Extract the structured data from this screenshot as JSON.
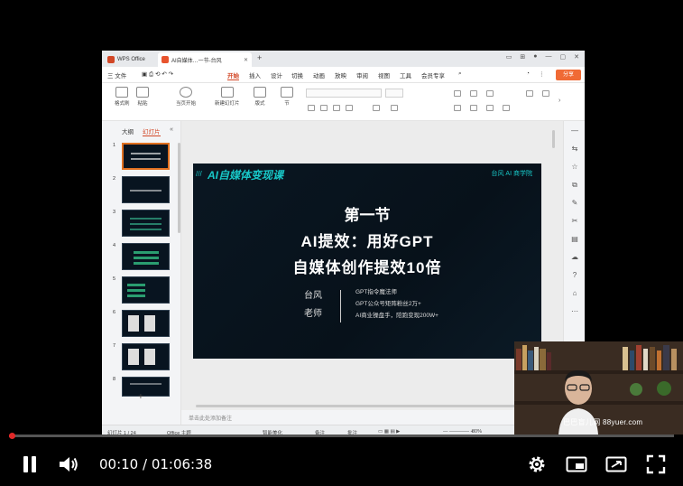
{
  "wps": {
    "tab_wps": "WPS Office",
    "tab_doc": "AI自媒体…一节-台风",
    "tab_add": "+",
    "menu": [
      "三 文件",
      "开始",
      "插入",
      "设计",
      "切换",
      "动画",
      "放映",
      "审阅",
      "视图",
      "工具",
      "会员专享"
    ],
    "active_menu": "开始",
    "share": "分享",
    "ribbon": [
      "格式刷",
      "粘贴",
      "当页开始",
      "新建幻灯片",
      "版式",
      "节"
    ],
    "panel_tabs": [
      "大纲",
      "幻灯片"
    ],
    "thumbnail_numbers": [
      "1",
      "2",
      "3",
      "4",
      "5",
      "6",
      "7",
      "8"
    ],
    "add_slide": "+",
    "notes_placeholder": "单击此处添加备注",
    "status": {
      "slide_count": "幻灯片 1 / 24",
      "theme": "Office 主题",
      "smart_beautify": "智能美化",
      "notes": "备注",
      "comments": "批注",
      "zoom": "80%"
    }
  },
  "slide": {
    "brand": "AI自媒体变现课",
    "org": "台风 AI 商学院",
    "title_1": "第一节",
    "title_2": "AI提效：用好GPT",
    "title_3": "自媒体创作提效10倍",
    "author_1": "台风",
    "author_2": "老师",
    "creds": [
      "GPT指令魔法师",
      "GPT公众号矩阵粉丝2万+",
      "AI商业操盘手，陪跑变现200W+"
    ]
  },
  "webcam": {
    "watermark": "巴巴盲儿网 88yuer.com"
  },
  "player": {
    "current_time": "00:10",
    "separator": " / ",
    "duration": "01:06:38",
    "progress": 0.0025,
    "accent": "#e02828"
  }
}
